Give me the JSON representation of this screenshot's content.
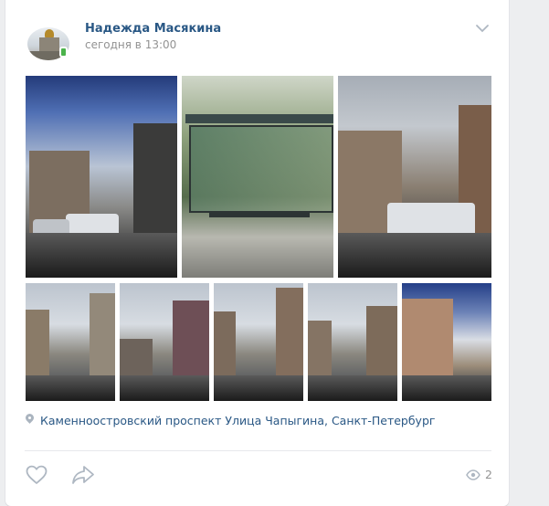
{
  "post": {
    "author": "Надежда Масякина",
    "time": "сегодня в 13:00",
    "location": "Каменноостровский проспект Улица Чапыгина, Санкт-Петербург",
    "views": "2"
  },
  "icons": {
    "more": "chevron-down-icon",
    "location": "map-pin-icon",
    "like": "heart-icon",
    "share": "share-arrow-icon",
    "views": "eye-icon",
    "online": "mobile-online-icon"
  },
  "colors": {
    "link": "#2a5885",
    "meta": "#939393",
    "icon": "#aeb7c2",
    "online": "#4bb34b",
    "background": "#edeef0"
  }
}
